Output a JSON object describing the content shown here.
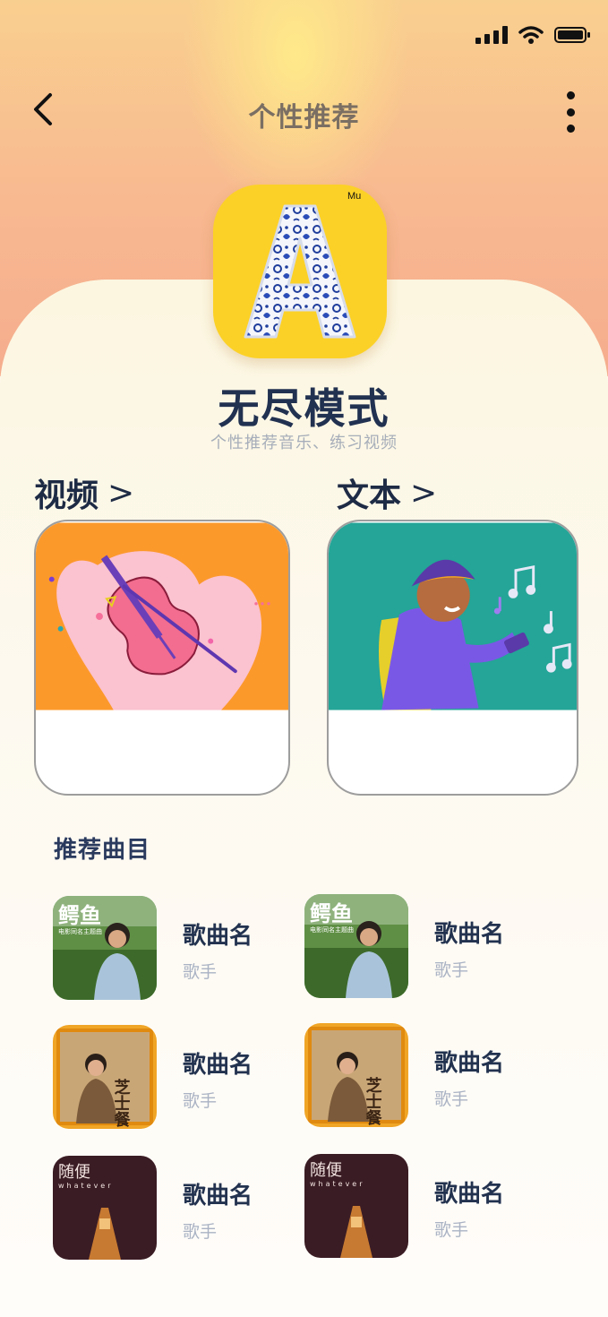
{
  "header": {
    "title": "个性推荐"
  },
  "mode": {
    "title": "无尽模式",
    "subtitle": "个性推荐音乐、练习视频",
    "icon_letter": "A"
  },
  "sections": [
    {
      "label": "视频",
      "chevron": ">"
    },
    {
      "label": "文本",
      "chevron": ">"
    }
  ],
  "recommend": {
    "title": "推荐曲目",
    "songs": [
      {
        "name": "歌曲名",
        "artist": "歌手",
        "cover": "鳄鱼",
        "cover_sub": "电影同名主题曲"
      },
      {
        "name": "歌曲名",
        "artist": "歌手",
        "cover": "鳄鱼",
        "cover_sub": "电影同名主题曲"
      },
      {
        "name": "歌曲名",
        "artist": "歌手",
        "cover": "芝士餐"
      },
      {
        "name": "歌曲名",
        "artist": "歌手",
        "cover": "芝士餐"
      },
      {
        "name": "歌曲名",
        "artist": "歌手",
        "cover": "随便",
        "cover_sub": "whatever"
      },
      {
        "name": "歌曲名",
        "artist": "歌手",
        "cover": "随便",
        "cover_sub": "whatever"
      }
    ]
  },
  "colors": {
    "accent": "#fcd127",
    "title": "#213150",
    "video_card": "#fc992b",
    "text_card": "#24a597"
  }
}
